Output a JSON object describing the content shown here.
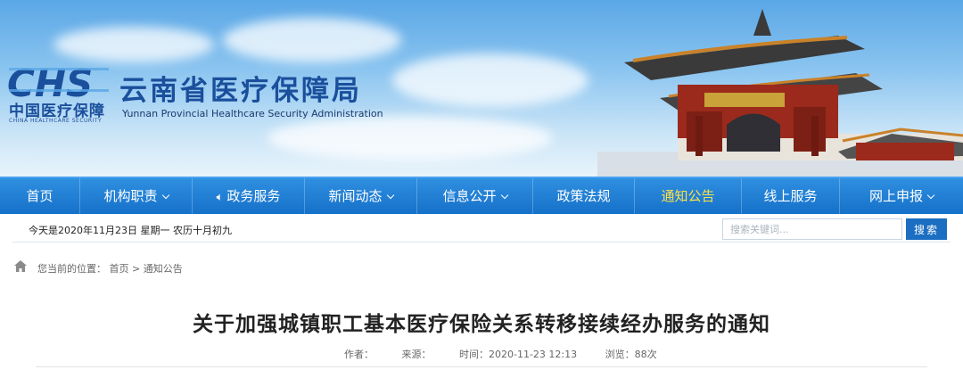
{
  "header": {
    "logo_cn": "中国医疗保障",
    "logo_en": "CHINA HEALTHCARE SECURITY",
    "title": "云南省医疗保障局",
    "subtitle": "Yunnan Provincial Healthcare Security Administration"
  },
  "nav": {
    "items": [
      {
        "label": "首页",
        "dropdown": false
      },
      {
        "label": "机构职责",
        "dropdown": true
      },
      {
        "label": "政务服务",
        "dropdown": false,
        "icon": "speaker-icon"
      },
      {
        "label": "新闻动态",
        "dropdown": true
      },
      {
        "label": "信息公开",
        "dropdown": true
      },
      {
        "label": "政策法规",
        "dropdown": false
      },
      {
        "label": "通知公告",
        "dropdown": false,
        "active": true
      },
      {
        "label": "线上服务",
        "dropdown": false
      },
      {
        "label": "网上申报",
        "dropdown": true
      }
    ],
    "active_color": "#ffe14a"
  },
  "infobar": {
    "date": "今天是2020年11月23日 星期一 农历十月初九",
    "search_placeholder": "搜索关键词...",
    "search_button": "搜索"
  },
  "breadcrumb": {
    "prefix": "您当前的位置：",
    "home": "首页",
    "separator": ">",
    "current": "通知公告"
  },
  "article": {
    "title": "关于加强城镇职工基本医疗保险关系转移接续经办服务的通知",
    "author_label": "作者：",
    "source_label": "来源：",
    "time_label": "时间：2020-11-23 12:13",
    "views_label": "浏览：88次"
  },
  "colors": {
    "brand_blue": "#1a4f9c",
    "nav_blue": "#1671c9",
    "search_button": "#1b6ec2"
  }
}
